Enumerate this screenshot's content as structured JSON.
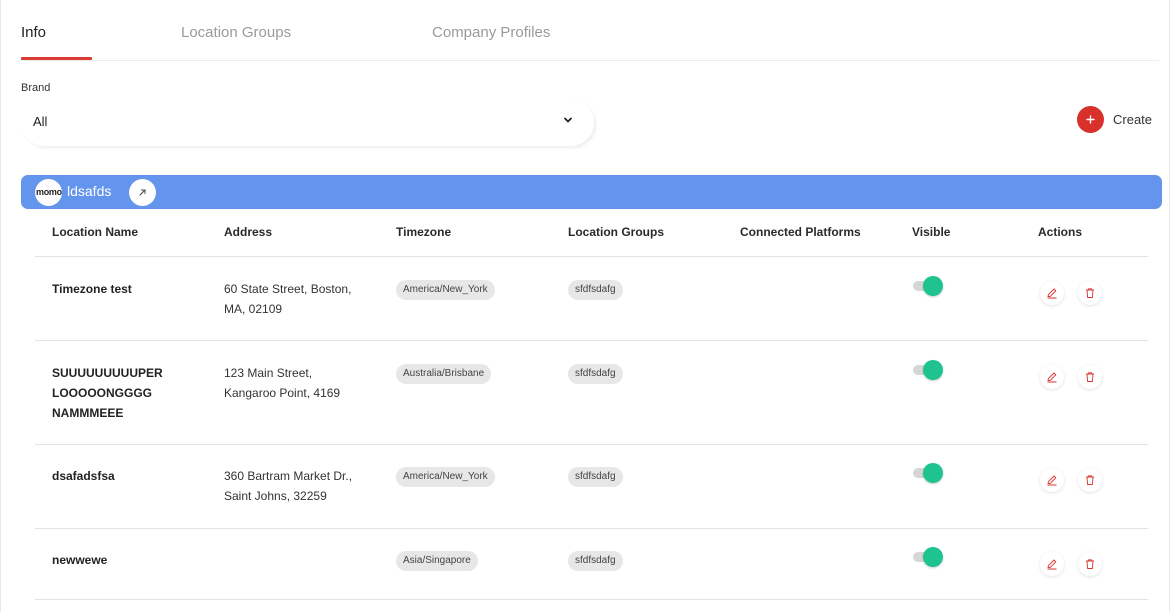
{
  "tabs": [
    {
      "label": "Info",
      "active": true
    },
    {
      "label": "Location Groups",
      "active": false
    },
    {
      "label": "Company Profiles",
      "active": false
    }
  ],
  "filter": {
    "label": "Brand",
    "selected": "All"
  },
  "create": {
    "label": "Create"
  },
  "brand": {
    "logo_text": "momo",
    "name": "ldsafds"
  },
  "table": {
    "columns": [
      "Location Name",
      "Address",
      "Timezone",
      "Location Groups",
      "Connected Platforms",
      "Visible",
      "Actions"
    ],
    "rows": [
      {
        "name_lines": [
          "Timezone test"
        ],
        "address_lines": [
          "60 State Street, Boston,",
          "MA, 02109"
        ],
        "timezone": "America/New_York",
        "group": "sfdfsdafg",
        "platforms": "",
        "visible": true
      },
      {
        "name_lines": [
          "SUUUUUUUUUPER",
          "LOOOOONGGGG",
          "NAMMMEEE"
        ],
        "address_lines": [
          "123 Main Street,",
          "Kangaroo Point, 4169"
        ],
        "timezone": "Australia/Brisbane",
        "group": "sfdfsdafg",
        "platforms": "",
        "visible": true
      },
      {
        "name_lines": [
          "dsafadsfsa"
        ],
        "address_lines": [
          "360 Bartram Market Dr.,",
          "Saint Johns, 32259"
        ],
        "timezone": "America/New_York",
        "group": "sfdfsdafg",
        "platforms": "",
        "visible": true
      },
      {
        "name_lines": [
          "newwewe"
        ],
        "address_lines": [],
        "timezone": "Asia/Singapore",
        "group": "sfdfsdafg",
        "platforms": "",
        "visible": true
      }
    ]
  },
  "colors": {
    "accent": "#d83a34",
    "brand_bar": "#6395ec",
    "toggle_on": "#1ec38f",
    "chip_bg": "#e7e7e7"
  },
  "icons": {
    "dropdown": "chevron-down-icon",
    "create": "plus-icon",
    "brand_link": "external-link-icon",
    "edit": "pencil-icon",
    "delete": "trash-icon"
  }
}
